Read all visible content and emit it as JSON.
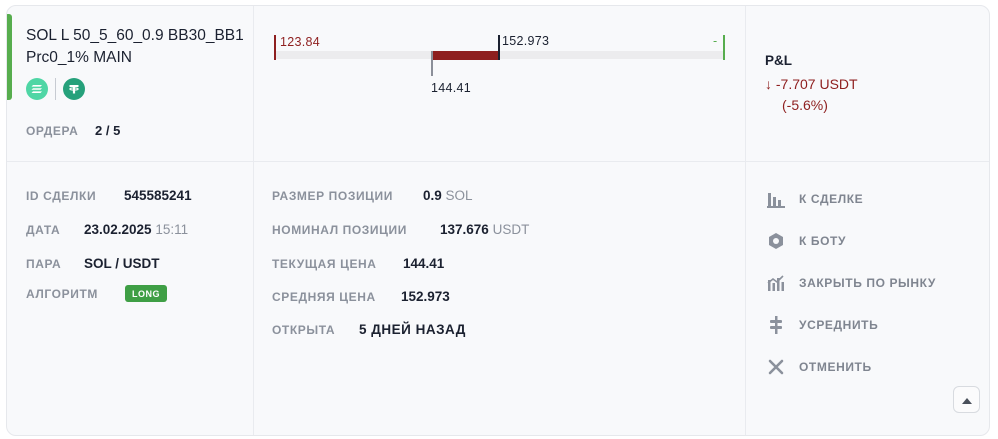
{
  "bot": {
    "title": "SOL L 50_5_60_0.9 BB30_BB1 Prc0_1% MAIN",
    "coins": [
      "sol-icon",
      "usdt-icon"
    ],
    "orders_label": "ОРДЕРА",
    "orders_value": "2 / 5",
    "status_color": "#57ad4e"
  },
  "price_bar": {
    "low_label": "123.84",
    "entry_label": "152.973",
    "current_label": "144.41",
    "target_label": "-",
    "colors": {
      "loss": "#8e1f1f",
      "low": "#8e1f1f",
      "target": "#57ad4e"
    }
  },
  "pnl": {
    "title": "P&L",
    "value": "-7.707 USDT",
    "percent": "(-5.6%)",
    "arrow": "↓"
  },
  "details_left": {
    "deal_id_label": "ID СДЕЛКИ",
    "deal_id_value": "545585241",
    "date_label": "ДАТА",
    "date_value": "23.02.2025",
    "time_value": "15:11",
    "pair_label": "ПАРА",
    "pair_value": "SOL / USDT",
    "algo_label": "АЛГОРИТМ",
    "algo_value": "LONG",
    "algo_color": "#3f9f45"
  },
  "details_mid": {
    "size_label": "РАЗМЕР ПОЗИЦИИ",
    "size_value": "0.9",
    "size_unit": "SOL",
    "notional_label": "НОМИНАЛ ПОЗИЦИИ",
    "notional_value": "137.676",
    "notional_unit": "USDT",
    "current_label": "ТЕКУЩАЯ ЦЕНА",
    "current_value": "144.41",
    "avg_label": "СРЕДНЯЯ ЦЕНА",
    "avg_value": "152.973",
    "opened_label": "ОТКРЫТА",
    "opened_value": "5 ДНЕЙ НАЗАД"
  },
  "actions": [
    {
      "label": "К СДЕЛКЕ",
      "icon": "bar-chart-icon"
    },
    {
      "label": "К БОТУ",
      "icon": "hexagon-nut-icon"
    },
    {
      "label": "ЗАКРЫТЬ ПО РЫНКУ",
      "icon": "market-close-icon"
    },
    {
      "label": "УСРЕДНИТЬ",
      "icon": "average-icon"
    },
    {
      "label": "ОТМЕНИТЬ",
      "icon": "close-icon"
    }
  ]
}
